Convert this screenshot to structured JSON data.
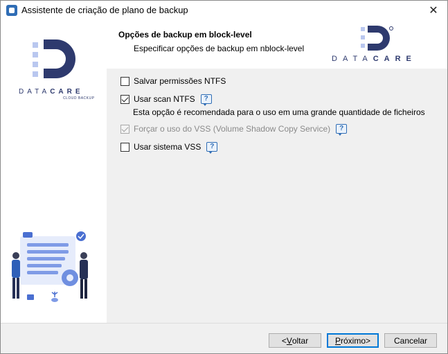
{
  "window": {
    "title": "Assistente de criação de plano de backup",
    "close_symbol": "✕"
  },
  "header": {
    "title": "Opções de backup em block-level",
    "subtitle": "Especificar opções de backup em nblock-level"
  },
  "brand": {
    "name_prefix": "DATA",
    "name_suffix": "CARE",
    "tagline": "CLOUD BACKUP",
    "primary_color": "#2e3a6e",
    "accent_color": "#b9c7ef"
  },
  "options": [
    {
      "label": "Salvar permissões NTFS",
      "checked": false,
      "enabled": true,
      "help": false
    },
    {
      "label": "Usar scan NTFS",
      "checked": true,
      "enabled": true,
      "help": true
    },
    {
      "label": "Forçar o uso do VSS (Volume Shadow Copy Service)",
      "checked": true,
      "enabled": false,
      "help": true
    },
    {
      "label": "Usar sistema VSS",
      "checked": false,
      "enabled": true,
      "help": true
    }
  ],
  "note": "Esta opção é recomendada para o uso em uma grande quantidade de ficheiros",
  "help_symbol": "?",
  "buttons": {
    "back": {
      "prefix": "<",
      "underline": "V",
      "rest": "oltar"
    },
    "next": {
      "underline": "P",
      "rest": "róximo>"
    },
    "cancel": "Cancelar"
  }
}
